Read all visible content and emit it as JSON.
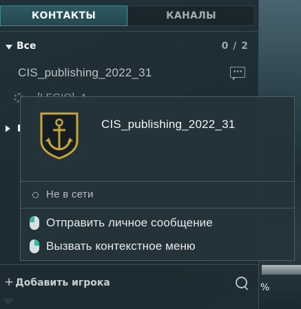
{
  "tabs": [
    {
      "label": "КОНТАКТЫ",
      "active": true
    },
    {
      "label": "КАНАЛЫ",
      "active": false
    }
  ],
  "group": {
    "name": "Все",
    "count": "0 / 2"
  },
  "contacts": [
    {
      "name": "CIS_publishing_2022_31"
    },
    {
      "name": "[LEGIO]_4..."
    }
  ],
  "bottom": {
    "add_player": "Добавить игрока",
    "add_icon": "+"
  },
  "background": {
    "percent": "%"
  },
  "card": {
    "name": "CIS_publishing_2022_31",
    "status": "Не в сети",
    "hints": [
      {
        "mouse": "left",
        "text": "Отправить личное сообщение"
      },
      {
        "mouse": "right",
        "text": "Вызвать контекстное меню"
      }
    ]
  },
  "colors": {
    "accent": "#3bb6a2",
    "gold": "#c9a437",
    "panel": "#1e2c32"
  },
  "icons": [
    "caret-down-icon",
    "message-icon",
    "gear-icon",
    "caret-right-icon",
    "search-icon",
    "anchor-emblem-icon",
    "mouse-left-icon",
    "mouse-right-icon",
    "offline-dot-icon"
  ]
}
